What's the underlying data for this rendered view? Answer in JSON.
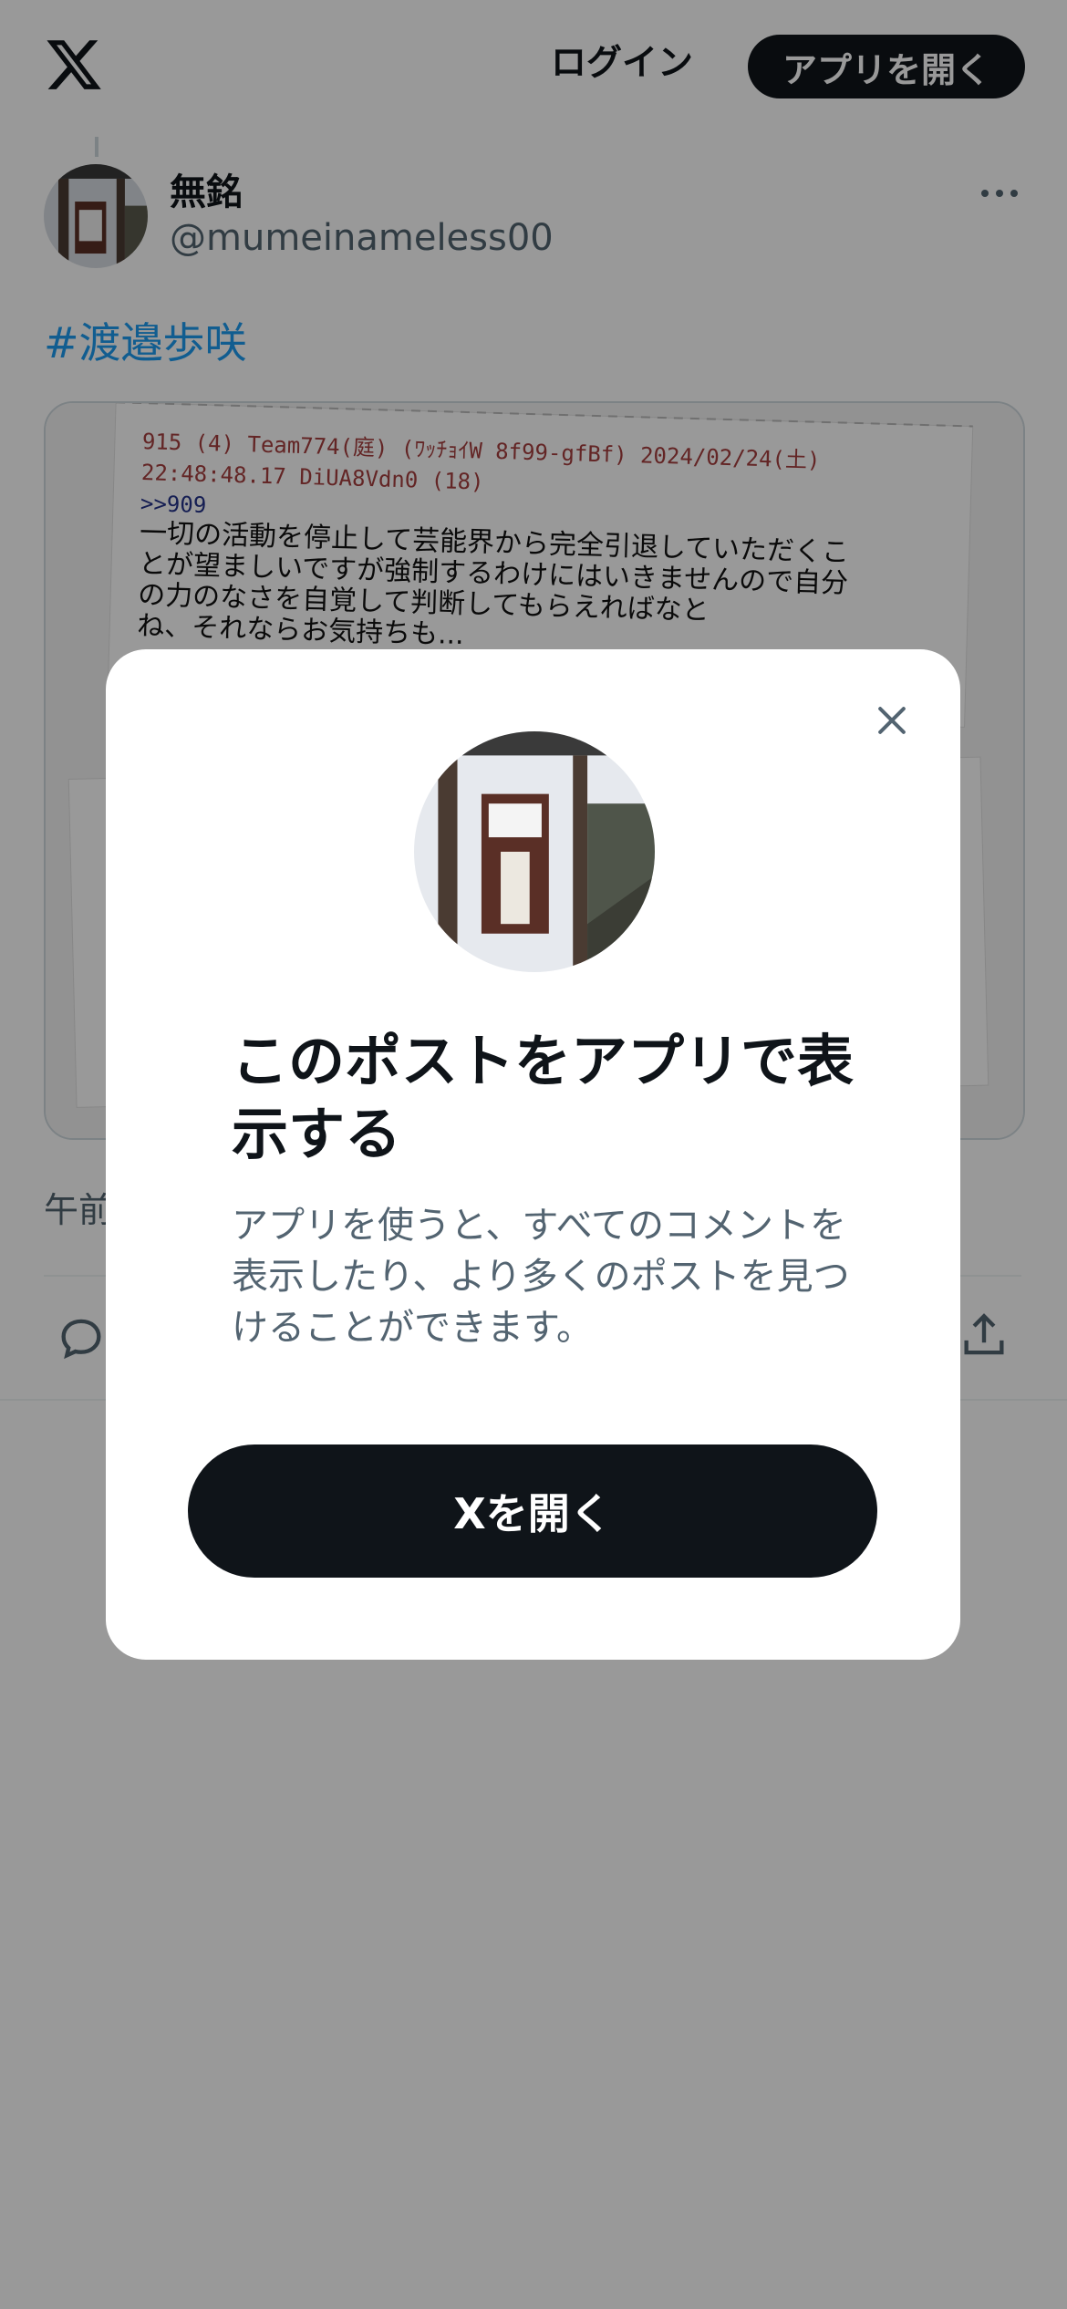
{
  "colors": {
    "accent": "#1d9bf0",
    "primary_button": "#0f1419",
    "secondary_text": "#536471",
    "backdrop": "rgba(0,0,0,0.4)"
  },
  "header": {
    "logo_icon": "x-logo-icon",
    "login_label": "ログイン",
    "open_app_label": "アプリを開く"
  },
  "post": {
    "author_name": "無銘",
    "author_handle": "@mumeinameless00",
    "hashtag": "#渡邉歩咲",
    "meta_partial": "午前",
    "media": {
      "lines": [
        "915 (4) Team774(庭) (ﾜｯﾁｮｲW 8f99-gfBf) 2024/02/24(土)",
        "22:48:48.17 DiUA8Vdn0 (18)",
        ">>909",
        "一切の活動を停止して芸能界から完全引退していただくこ",
        "とが望ましいですが強制するわけにはいきませんので自分",
        "の力のなさを自覚して判断してもらえればなと",
        "ね、それならお気持ちも..."
      ]
    },
    "actions": {
      "reply_icon": "reply-icon",
      "share_icon": "share-icon"
    }
  },
  "modal": {
    "close_icon": "close-icon",
    "title": "このポストをアプリで表示する",
    "description": "アプリを使うと、すべてのコメントを表示したり、より多くのポストを見つけることができます。",
    "cta_label": "Xを開く"
  }
}
